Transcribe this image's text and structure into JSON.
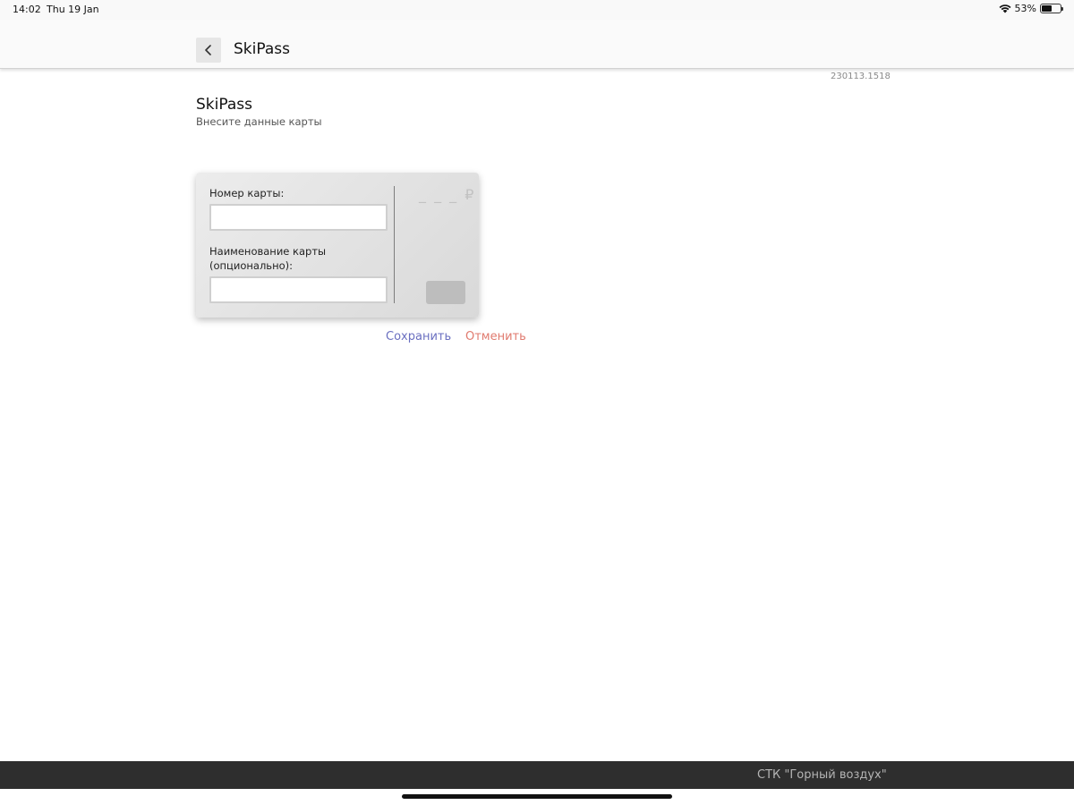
{
  "status_bar": {
    "time": "14:02",
    "date": "Thu 19 Jan",
    "battery_text": "53%",
    "battery_level": 0.53
  },
  "header": {
    "title": "SkiPass",
    "back_icon": "chevron-left-icon"
  },
  "build_version": "230113.1518",
  "page": {
    "title": "SkiPass",
    "subtitle": "Внесите данные карты"
  },
  "card": {
    "number_label": "Номер карты:",
    "number_value": "",
    "name_label": "Наименование карты (опционально):",
    "name_value": "",
    "balance": "_ _ _ ₽"
  },
  "actions": {
    "save": "Сохранить",
    "cancel": "Отменить"
  },
  "footer": {
    "company": "СТК \"Горный воздух\""
  },
  "colors": {
    "save": "#6a6fc0",
    "cancel": "#e07a6e",
    "footer_bg": "#2e2e2e"
  }
}
